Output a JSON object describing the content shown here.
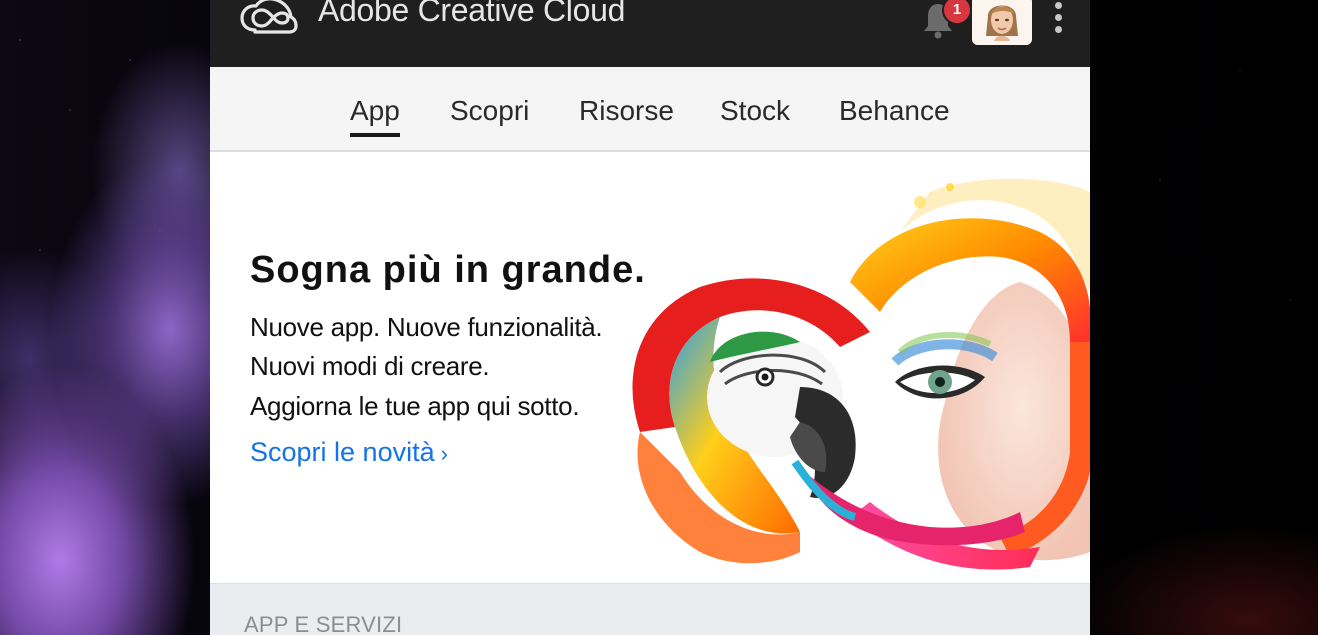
{
  "header": {
    "app_title": "Adobe Creative Cloud",
    "notification_count": "1",
    "logo_icon": "creative-cloud-logo-icon",
    "bell_icon": "bell-icon",
    "more_icon": "vertical-ellipsis-icon"
  },
  "nav": {
    "tabs": [
      {
        "label": "App",
        "active": true
      },
      {
        "label": "Scopri",
        "active": false
      },
      {
        "label": "Risorse",
        "active": false
      },
      {
        "label": "Stock",
        "active": false
      },
      {
        "label": "Behance",
        "active": false
      }
    ]
  },
  "hero": {
    "title": "Sogna più in grande.",
    "lines": [
      "Nuove app. Nuove funzionalità.",
      "Nuovi modi di creare.",
      "Aggiorna le tue app qui sotto."
    ],
    "link_label": "Scopri le novità",
    "link_chevron": "›"
  },
  "section": {
    "label": "APP E SERVIZI"
  },
  "colors": {
    "topbar": "#1f1f1f",
    "accent_link": "#1473e6",
    "badge": "#d7373f",
    "nav_bg": "#f5f5f5"
  }
}
